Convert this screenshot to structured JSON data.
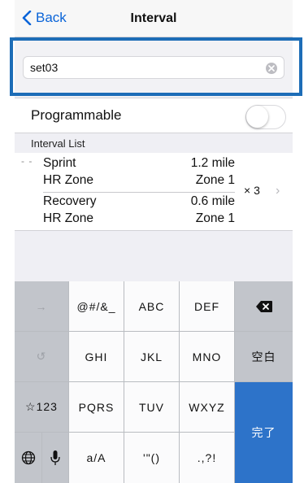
{
  "nav": {
    "back_label": "Back",
    "title": "Interval"
  },
  "name_field": {
    "value": "set03"
  },
  "programmable": {
    "label": "Programmable",
    "enabled": false
  },
  "interval_list": {
    "header": "Interval List",
    "drag_handle": "- -",
    "segments": [
      {
        "name": "Sprint",
        "distance": "1.2 mile",
        "zone_label": "HR Zone",
        "zone_value": "Zone 1"
      },
      {
        "name": "Recovery",
        "distance": "0.6 mile",
        "zone_label": "HR Zone",
        "zone_value": "Zone 1"
      }
    ],
    "repeat": "× 3",
    "chevron": "›"
  },
  "keyboard": {
    "row1": {
      "arrow": "→",
      "k1": "@#/&_",
      "k2": "ABC",
      "k3": "DEF"
    },
    "row2": {
      "undo": "↺",
      "k1": "GHI",
      "k2": "JKL",
      "k3": "MNO",
      "space": "空白"
    },
    "row3": {
      "mode": "☆123",
      "k1": "PQRS",
      "k2": "TUV",
      "k3": "WXYZ"
    },
    "row4": {
      "k1": "a/A",
      "k2": "'\"()",
      "k3": ".,?!"
    },
    "done": "完了"
  },
  "colors": {
    "accent": "#0a64d8",
    "done_key": "#2d73c9",
    "annotation_box": "#1d6db7"
  }
}
